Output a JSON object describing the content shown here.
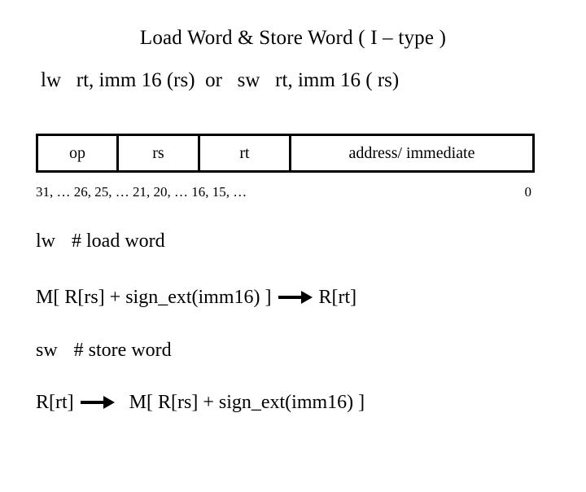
{
  "slide": {
    "title": "Load Word & Store Word ( I – type )",
    "syntax": "lw   rt, imm 16 (rs)  or   sw   rt, imm 16 ( rs)",
    "instruction_format": {
      "fields": [
        {
          "name": "op",
          "bits": "31, … 26"
        },
        {
          "name": "rs",
          "bits": "25, … 21"
        },
        {
          "name": "rt",
          "bits": "20, … 16"
        },
        {
          "name": "address/ immediate",
          "bits": "15, … 0"
        }
      ],
      "bit_labels_left": "31, … 26, 25, … 21, 20, … 16, 15, …",
      "bit_labels_right": "0"
    },
    "operations": [
      {
        "mnemonic": "lw",
        "comment": "# load word",
        "semantics_left": "M[ R[rs] + sign_ext(imm16) ]",
        "arrow": "right-arrow-icon",
        "semantics_right": "R[rt]"
      },
      {
        "mnemonic": "sw",
        "comment": "# store word",
        "semantics_left": "R[rt]",
        "arrow": "right-arrow-icon",
        "semantics_right": "M[ R[rs] + sign_ext(imm16) ]"
      }
    ]
  },
  "colors": {
    "background": "#ffffff",
    "text": "#000000",
    "border": "#000000"
  }
}
